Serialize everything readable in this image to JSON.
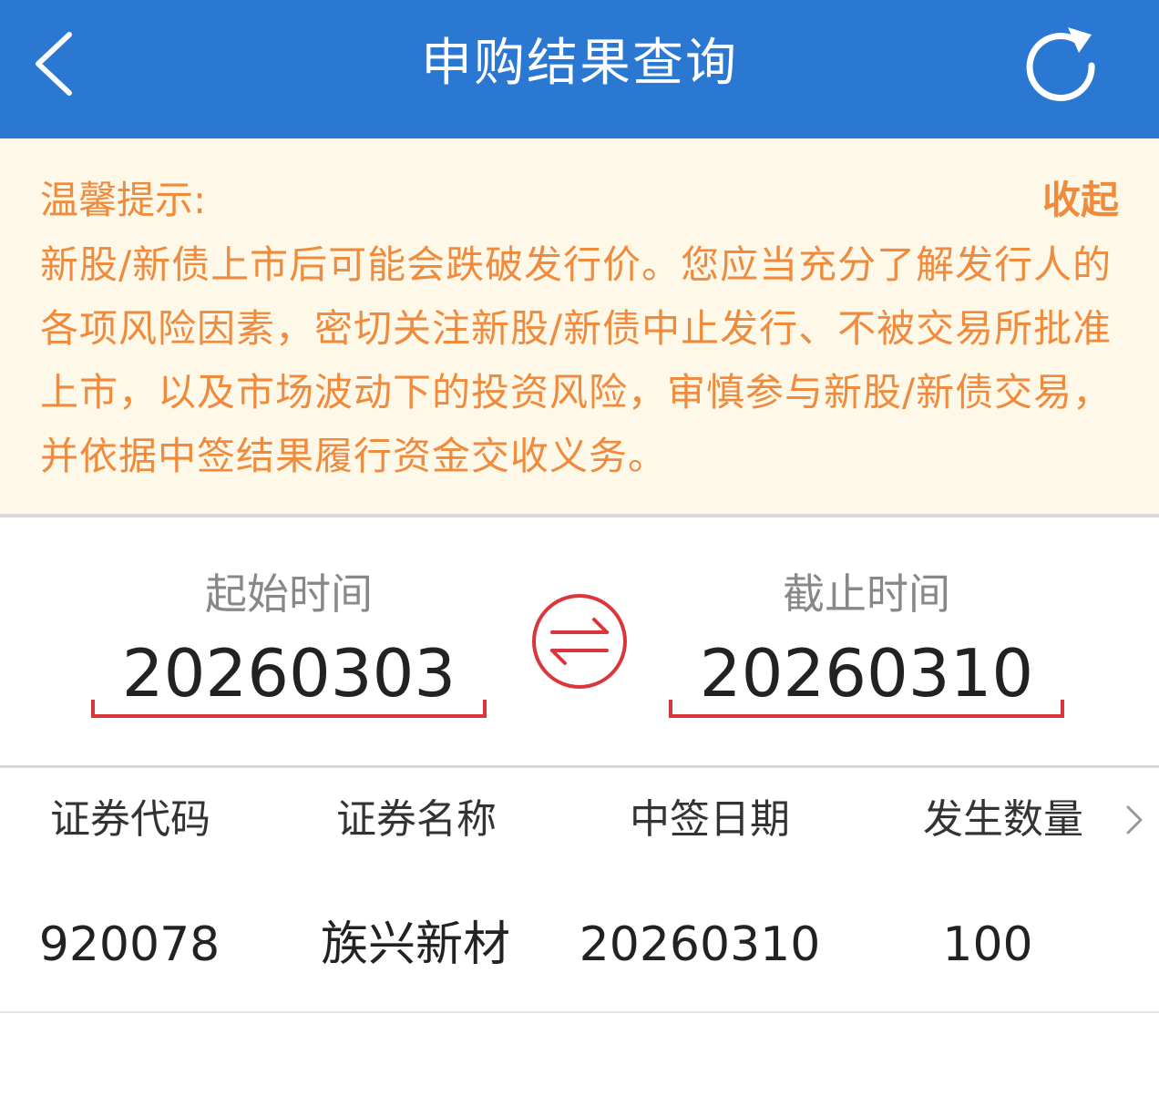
{
  "header": {
    "title": "申购结果查询",
    "back_icon": "chevron-left-icon",
    "refresh_icon": "refresh-icon",
    "background_color": "#2a78d2"
  },
  "notice": {
    "label": "温馨提示:",
    "collapse_label": "收起",
    "text": "新股/新债上市后可能会跌破发行价。您应当充分了解发行人的各项风险因素，密切关注新股/新债中止发行、不被交易所批准上市，以及市场波动下的投资风险，审慎参与新股/新债交易，并依据中签结果履行资金交收义务。",
    "text_color": "#f08a3c",
    "background_color": "#fdf8e8"
  },
  "date_range": {
    "start_label": "起始时间",
    "start_value": "20260303",
    "end_label": "截止时间",
    "end_value": "20260310",
    "swap_icon": "swap-arrows-icon",
    "accent_color": "#d9373c"
  },
  "table": {
    "columns": [
      "证券代码",
      "证券名称",
      "中签日期",
      "发生数量"
    ],
    "more_icon": "chevron-right-icon",
    "rows": [
      {
        "code": "920078",
        "name": "族兴新材",
        "date": "20260310",
        "quantity": "100"
      }
    ]
  }
}
